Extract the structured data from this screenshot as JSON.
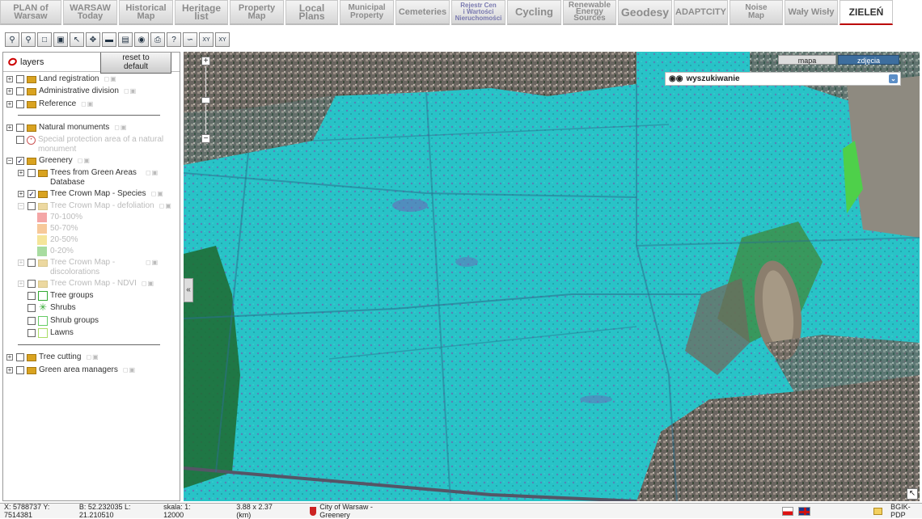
{
  "nav": {
    "tabs": [
      {
        "line1": "PLAN of",
        "line2": "Warsaw"
      },
      {
        "line1": "WARSAW",
        "line2": "Today"
      },
      {
        "line1": "Historical",
        "line2": "Map"
      },
      {
        "line1": "Heritage",
        "line2": "list"
      },
      {
        "line1": "Property",
        "line2": "Map"
      },
      {
        "line1": "Local",
        "line2": "Plans"
      },
      {
        "line1": "Municipal",
        "line2": "Property"
      },
      {
        "line1": "Cemeteries",
        "line2": ""
      },
      {
        "line1": "Rejestr Cen",
        "line2": "i Wartości",
        "line3": "Nieruchomości"
      },
      {
        "line1": "Cycling",
        "line2": ""
      },
      {
        "line1": "Renewable",
        "line2": "Energy",
        "line3": "Sources"
      },
      {
        "line1": "Geodesy",
        "line2": ""
      },
      {
        "line1": "ADAPTCITY",
        "line2": ""
      },
      {
        "line1": "Noise",
        "line2": "Map"
      },
      {
        "line1": "Wały Wisły",
        "line2": ""
      },
      {
        "line1": "ZIELEŃ",
        "line2": ""
      }
    ],
    "active_index": 15
  },
  "panel": {
    "title": "layers",
    "reset_label": "reset to default",
    "layers": {
      "land_registration": "Land registration",
      "administrative_division": "Administrative division",
      "reference": "Reference",
      "natural_monuments": "Natural monuments",
      "special_protection_1": "Special protection area of a natural",
      "special_protection_2": "monument",
      "greenery": "Greenery",
      "trees_green_1": "Trees from Green Areas",
      "trees_green_2": "Database",
      "crown_species": "Tree Crown Map - Species",
      "crown_defoliation": "Tree Crown Map - defoliation",
      "defol_70_100": "70-100%",
      "defol_50_70": "50-70%",
      "defol_20_50": "20-50%",
      "defol_0_20": "0-20%",
      "crown_discolor_1": "Tree Crown Map -",
      "crown_discolor_2": "discolorations",
      "crown_ndvi": "Tree Crown Map - NDVI",
      "tree_groups": "Tree groups",
      "shrubs": "Shrubs",
      "shrub_groups": "Shrub groups",
      "lawns": "Lawns",
      "tree_cutting": "Tree cutting",
      "green_area_managers": "Green area managers"
    },
    "legend_colors": {
      "defol_70_100": "#f4a6a6",
      "defol_50_70": "#f7c99a",
      "defol_20_50": "#f5e59a",
      "defol_0_20": "#a8dca0"
    }
  },
  "map": {
    "btn_map": "mapa",
    "btn_photos": "zdjęcia",
    "search_label": "wyszukiwanie"
  },
  "status": {
    "coords": "X: 5788737 Y: 7514381",
    "latlon": "B: 52.232035 L: 21.210510",
    "scale": "skala: 1: 12000",
    "extent": "3.88 x 2.37 (km)",
    "source": "City of Warsaw - Greenery",
    "credit": "BGIK-PDP"
  }
}
